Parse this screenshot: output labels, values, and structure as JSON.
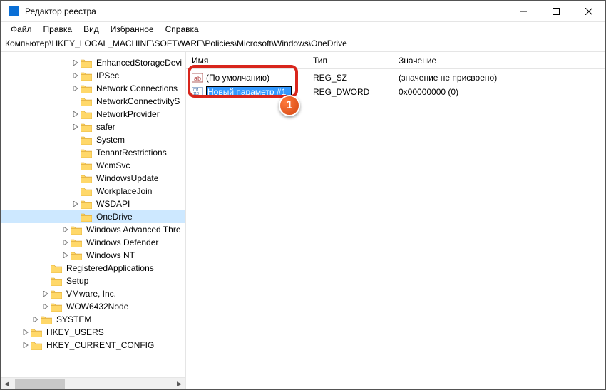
{
  "titlebar": {
    "title": "Редактор реестра"
  },
  "menubar": {
    "file": "Файл",
    "edit": "Правка",
    "view": "Вид",
    "favorites": "Избранное",
    "help": "Справка"
  },
  "addressbar": {
    "path": "Компьютер\\HKEY_LOCAL_MACHINE\\SOFTWARE\\Policies\\Microsoft\\Windows\\OneDrive"
  },
  "tree": {
    "items": [
      {
        "indent": 7,
        "tw": ">",
        "label": "EnhancedStorageDevi"
      },
      {
        "indent": 7,
        "tw": ">",
        "label": "IPSec"
      },
      {
        "indent": 7,
        "tw": ">",
        "label": "Network Connections"
      },
      {
        "indent": 7,
        "tw": "",
        "label": "NetworkConnectivityS"
      },
      {
        "indent": 7,
        "tw": ">",
        "label": "NetworkProvider"
      },
      {
        "indent": 7,
        "tw": ">",
        "label": "safer"
      },
      {
        "indent": 7,
        "tw": "",
        "label": "System"
      },
      {
        "indent": 7,
        "tw": "",
        "label": "TenantRestrictions"
      },
      {
        "indent": 7,
        "tw": "",
        "label": "WcmSvc"
      },
      {
        "indent": 7,
        "tw": "",
        "label": "WindowsUpdate"
      },
      {
        "indent": 7,
        "tw": "",
        "label": "WorkplaceJoin"
      },
      {
        "indent": 7,
        "tw": ">",
        "label": "WSDAPI"
      },
      {
        "indent": 7,
        "tw": "",
        "label": "OneDrive",
        "selected": true
      },
      {
        "indent": 6,
        "tw": ">",
        "label": "Windows Advanced Thre"
      },
      {
        "indent": 6,
        "tw": ">",
        "label": "Windows Defender"
      },
      {
        "indent": 6,
        "tw": ">",
        "label": "Windows NT"
      },
      {
        "indent": 4,
        "tw": "",
        "label": "RegisteredApplications"
      },
      {
        "indent": 4,
        "tw": "",
        "label": "Setup"
      },
      {
        "indent": 4,
        "tw": ">",
        "label": "VMware, Inc."
      },
      {
        "indent": 4,
        "tw": ">",
        "label": "WOW6432Node"
      },
      {
        "indent": 3,
        "tw": ">",
        "label": "SYSTEM"
      },
      {
        "indent": 2,
        "tw": ">",
        "label": "HKEY_USERS"
      },
      {
        "indent": 2,
        "tw": ">",
        "label": "HKEY_CURRENT_CONFIG"
      }
    ]
  },
  "list": {
    "headers": {
      "name": "Имя",
      "type": "Тип",
      "value": "Значение"
    },
    "rows": [
      {
        "icon": "sz",
        "name": "(По умолчанию)",
        "type": "REG_SZ",
        "value": "(значение не присвоено)",
        "editing": false
      },
      {
        "icon": "dw",
        "name": "Новый параметр #1",
        "type": "REG_DWORD",
        "value": "0x00000000 (0)",
        "editing": true
      }
    ]
  },
  "annotation": {
    "badge": "1"
  }
}
